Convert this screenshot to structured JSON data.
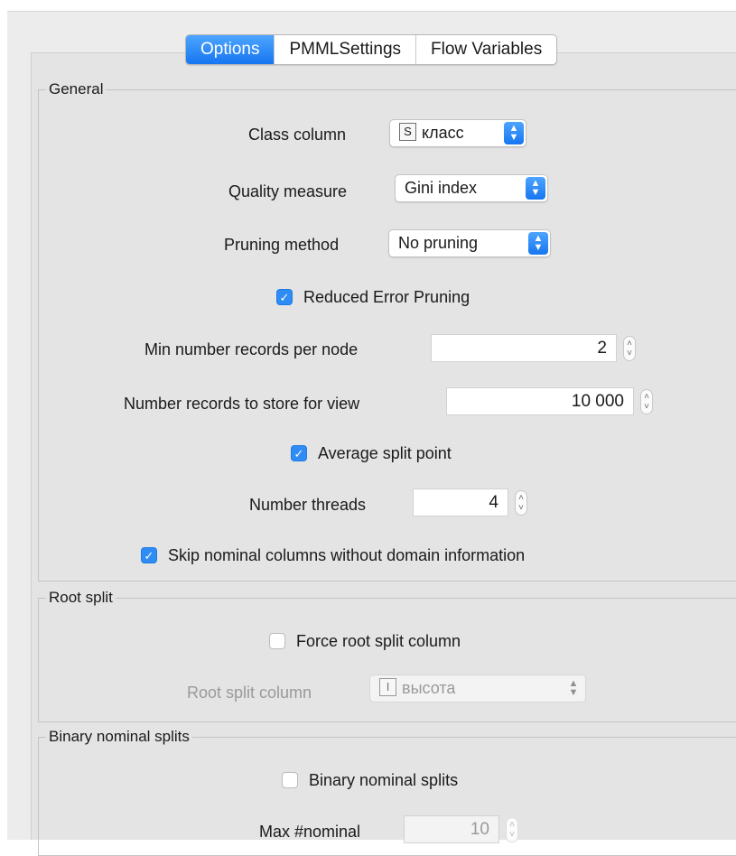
{
  "tabs": [
    {
      "label": "Options",
      "active": true
    },
    {
      "label": "PMMLSettings",
      "active": false
    },
    {
      "label": "Flow Variables",
      "active": false
    }
  ],
  "general": {
    "title": "General",
    "class_column": {
      "label": "Class column",
      "type_badge": "S",
      "value": "класс"
    },
    "quality_measure": {
      "label": "Quality measure",
      "value": "Gini index"
    },
    "pruning_method": {
      "label": "Pruning method",
      "value": "No pruning"
    },
    "reduced_error_pruning": {
      "label": "Reduced Error Pruning",
      "checked": true
    },
    "min_records": {
      "label": "Min number records per node",
      "value": "2"
    },
    "records_store": {
      "label": "Number records to store for view",
      "value": "10 000"
    },
    "average_split": {
      "label": "Average split point",
      "checked": true
    },
    "threads": {
      "label": "Number threads",
      "value": "4"
    },
    "skip_nominal": {
      "label": "Skip nominal columns without domain information",
      "checked": true
    }
  },
  "root_split": {
    "title": "Root split",
    "force": {
      "label": "Force root split column",
      "checked": false
    },
    "column": {
      "label": "Root split column",
      "type_badge": "I",
      "value": "высота"
    }
  },
  "binary_nominal": {
    "title": "Binary nominal splits",
    "binary": {
      "label": "Binary nominal splits",
      "checked": false
    },
    "max_nominal": {
      "label": "Max #nominal",
      "value": "10"
    }
  },
  "colors": {
    "accent": "#1f7ae4",
    "panel": "#e4e4e4",
    "disabled_text": "#9a9a9a"
  }
}
